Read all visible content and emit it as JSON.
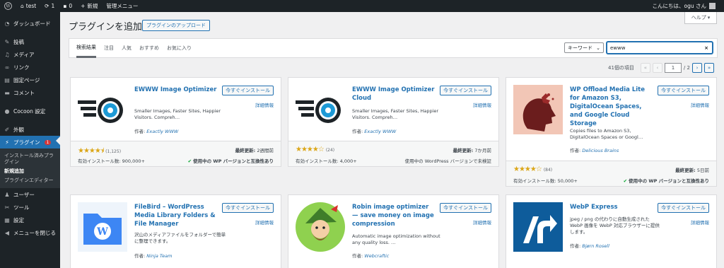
{
  "adminbar": {
    "site_name": "test",
    "updates": "1",
    "comments": "0",
    "new": "新規",
    "admin_menu": "管理メニュー",
    "greeting": "こんにちは、ogu さん"
  },
  "sidebar": {
    "items": [
      {
        "label": "ダッシュボード",
        "icon": "dashboard-icon"
      },
      {
        "label": "投稿",
        "icon": "pin-icon"
      },
      {
        "label": "メディア",
        "icon": "media-icon"
      },
      {
        "label": "リンク",
        "icon": "link-icon"
      },
      {
        "label": "固定ページ",
        "icon": "page-icon"
      },
      {
        "label": "コメント",
        "icon": "comment-icon"
      },
      {
        "label": "Cocoon 設定",
        "icon": "cocoon-icon"
      },
      {
        "label": "外観",
        "icon": "brush-icon"
      },
      {
        "label": "プラグイン",
        "icon": "plugin-icon",
        "badge": "1"
      },
      {
        "label": "ユーザー",
        "icon": "user-icon"
      },
      {
        "label": "ツール",
        "icon": "wrench-icon"
      },
      {
        "label": "設定",
        "icon": "settings-icon"
      },
      {
        "label": "メニューを閉じる",
        "icon": "collapse-icon"
      }
    ],
    "submenu": [
      "インストール済みプラグイン",
      "新規追加",
      "プラグインエディター"
    ]
  },
  "help_label": "ヘルプ",
  "page_title": "プラグインを追加",
  "upload_button": "プラグインのアップロード",
  "tabs": [
    "検索結果",
    "注目",
    "人気",
    "おすすめ",
    "お気に入り"
  ],
  "search": {
    "type": "キーワード",
    "value": "ewww"
  },
  "pagination": {
    "count": "41個の項目",
    "first": "«",
    "prev": "‹",
    "current": "1",
    "total": "/ 2",
    "next": "›",
    "last": "»"
  },
  "card_labels": {
    "install": "今すぐインストール",
    "details": "詳細情報",
    "by": "作者:",
    "last_updated": "最終更新:",
    "installs": "有効インストール数:"
  },
  "cards": [
    {
      "name": "EWWW Image Optimizer",
      "desc": "Smaller Images, Faster Sites, Happier Visitors. Compreh…",
      "author": "Exactly WWW",
      "stars": "★★★★⯨",
      "rating_count": "(1,125)",
      "updated": "2週間前",
      "installs": "900,000+",
      "compat": "使用中の WP バージョンと互換性あり",
      "compatible": true
    },
    {
      "name": "EWWW Image Optimizer Cloud",
      "desc": "Smaller Images, Faster Sites, Happier Visitors. Compreh…",
      "author": "Exactly WWW",
      "stars": "★★★★☆",
      "rating_count": "(24)",
      "updated": "7か月前",
      "installs": "4,000+",
      "compat": "使用中の WordPress バージョンで未検証",
      "compatible": false
    },
    {
      "name": "WP Offload Media Lite for Amazon S3, DigitalOcean Spaces, and Google Cloud Storage",
      "desc": "Copies files to Amazon S3, DigitalOcean Spaces or Googl…",
      "author": "Delicious Brains",
      "stars": "★★★★☆",
      "rating_count": "(84)",
      "updated": "5日前",
      "installs": "50,000+",
      "compat": "使用中の WP バージョンと互換性あり",
      "compatible": true
    },
    {
      "name": "FileBird – WordPress Media Library Folders & File Manager",
      "desc": "沢山のメディアファイルをフォルダーで簡単に整理できます。",
      "author": "Ninja Team"
    },
    {
      "name": "Robin image optimizer — save money on image compression",
      "desc": "Automatic image optimization without any quality loss. …",
      "author": "Webcraftic"
    },
    {
      "name": "WebP Express",
      "desc": "jpeg / png の代わりに自動生成された WebP 画像を WebP 対応ブラウザーに提供します。",
      "author": "Bjørn Rosell"
    }
  ],
  "colors": {
    "accent": "#2271b1",
    "admin_dark": "#1d2327",
    "star": "#dba617",
    "ok": "#00a32a"
  }
}
